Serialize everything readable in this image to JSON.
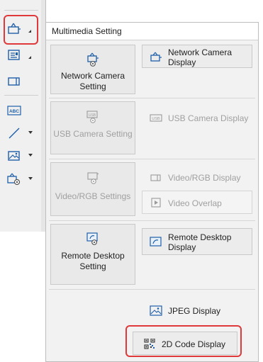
{
  "toolbar": {
    "items": [
      {
        "name": "network-camera-tool",
        "icon": "network-camera-icon",
        "has_dropdown": true,
        "highlighted": true
      },
      {
        "name": "display-tool",
        "icon": "display-icon",
        "has_dropdown": true
      },
      {
        "name": "monitor-tool",
        "icon": "monitor-icon",
        "has_dropdown": false
      },
      {
        "name": "text-tool",
        "icon": "abc-text-icon",
        "icon_text": "ABC",
        "has_dropdown": false
      },
      {
        "name": "line-tool",
        "icon": "line-icon",
        "has_dropdown": true
      },
      {
        "name": "image-tool",
        "icon": "image-icon",
        "has_dropdown": true
      },
      {
        "name": "multimedia-tool",
        "icon": "multimedia-icon",
        "has_dropdown": true
      }
    ]
  },
  "panel": {
    "title": "Multimedia Setting",
    "network_camera_setting": "Network Camera Setting",
    "network_camera_display": "Network Camera Display",
    "usb_camera_setting": "USB Camera Setting",
    "usb_camera_display": "USB Camera Display",
    "usb_icon_text": "USB",
    "video_rgb_settings": "Video/RGB Settings",
    "video_rgb_display": "Video/RGB Display",
    "video_overlap": "Video Overlap",
    "remote_desktop_setting": "Remote Desktop Setting",
    "remote_desktop_display": "Remote Desktop Display",
    "jpeg_display": "JPEG Display",
    "code_2d_display": "2D Code Display"
  },
  "colors": {
    "highlight": "#e0393b",
    "icon_blue": "#1f5fa8",
    "disabled_text": "#a0a0a0"
  }
}
